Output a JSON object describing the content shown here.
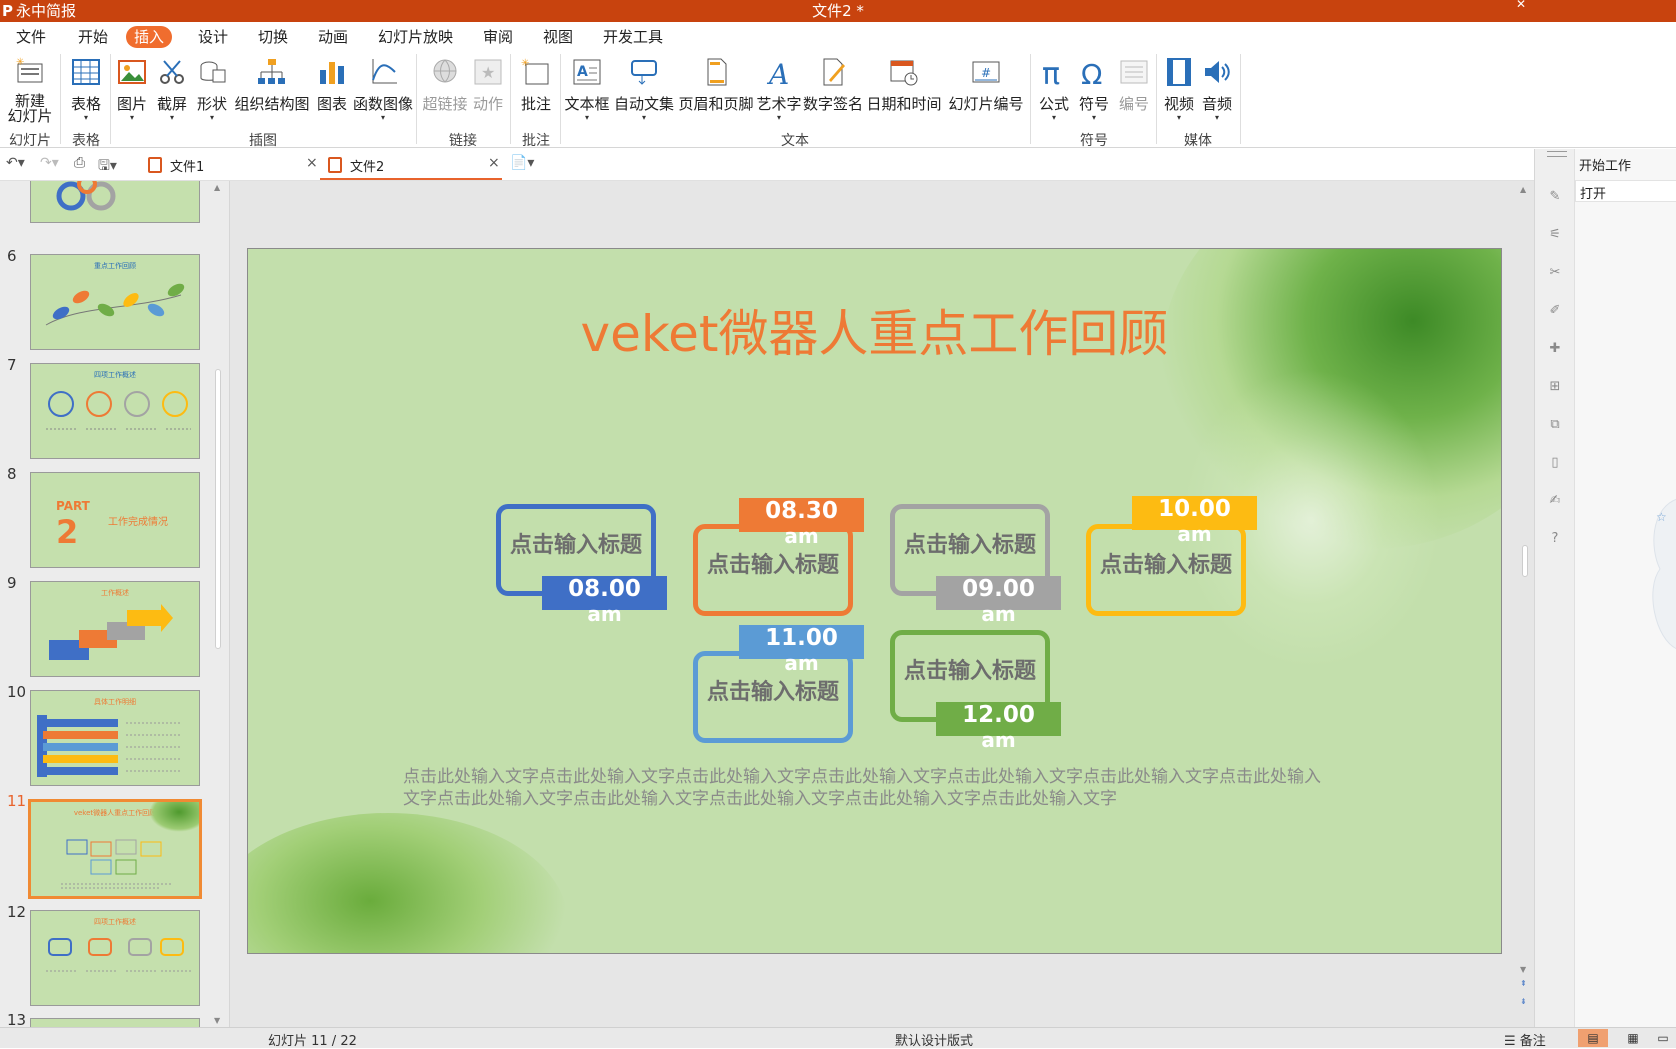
{
  "titlebar": {
    "app_name": "永中简报",
    "doc_title": "文件2 *"
  },
  "menu": [
    "文件",
    "开始",
    "插入",
    "设计",
    "切换",
    "动画",
    "幻灯片放映",
    "审阅",
    "视图",
    "开发工具"
  ],
  "ribbon": {
    "new_slide": "新建\n幻灯片",
    "table": "表格",
    "picture": "图片",
    "screenshot": "截屏",
    "shape": "形状",
    "org_chart": "组织结构图",
    "chart": "图表",
    "func_image": "函数图像",
    "hyperlink": "超链接",
    "action": "动作",
    "comment": "批注",
    "textbox": "文本框",
    "auto_text": "自动文集",
    "header_footer": "页眉和页脚",
    "wordart": "艺术字",
    "signature": "数字签名",
    "datetime": "日期和时间",
    "slide_number": "幻灯片编号",
    "formula": "公式",
    "symbol": "符号",
    "numbering": "编号",
    "video": "视频",
    "audio": "音频",
    "groups": {
      "slide": "幻灯片",
      "table": "表格",
      "illustration": "插图",
      "link": "链接",
      "comment": "批注",
      "text": "文本",
      "symbol": "符号",
      "media": "媒体"
    }
  },
  "tabs": {
    "doc1": "文件1",
    "doc2": "文件2"
  },
  "thumbs": {
    "numbers": [
      "6",
      "7",
      "8",
      "9",
      "10",
      "11",
      "12",
      "13"
    ],
    "t6": "重点工作回顾",
    "t7": "四项工作概述",
    "t8_part": "PART",
    "t8_num": "2",
    "t8_sub": "工作完成情况",
    "t9": "工作概述",
    "t10": "具体工作明细",
    "t11": "veket微器人重点工作回顾",
    "t12": "四项工作概述"
  },
  "slide": {
    "title": "veket微器人重点工作回顾",
    "card_title": "点击输入标题",
    "times": [
      {
        "time": "08.00",
        "ampm": "am",
        "color": "#3f6fc6"
      },
      {
        "time": "08.30",
        "ampm": "am",
        "color": "#ee7a35"
      },
      {
        "time": "09.00",
        "ampm": "am",
        "color": "#a3a3a3"
      },
      {
        "time": "10.00",
        "ampm": "am",
        "color": "#fdbb12"
      },
      {
        "time": "11.00",
        "ampm": "am",
        "color": "#5b9bd5"
      },
      {
        "time": "12.00",
        "ampm": "am",
        "color": "#70ad47"
      }
    ],
    "body": "点击此处输入文字点击此处输入文字点击此处输入文字点击此处输入文字点击此处输入文字点击此处输入文字点击此处输入文字点击此处输入文字点击此处输入文字点击此处输入文字点击此处输入文字点击此处输入文字"
  },
  "taskpane": {
    "header": "开始工作",
    "open": "打开"
  },
  "status": {
    "slide_count": "幻灯片 11 / 22",
    "design": "默认设计版式",
    "notes": "备注"
  }
}
